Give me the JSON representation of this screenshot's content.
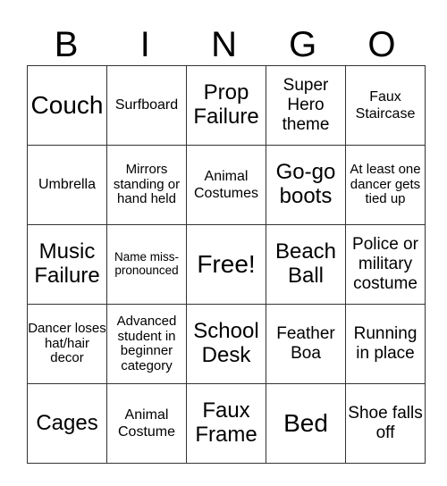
{
  "header": [
    "B",
    "I",
    "N",
    "G",
    "O"
  ],
  "grid": [
    [
      "Couch",
      "Surfboard",
      "Prop Failure",
      "Super Hero theme",
      "Faux Staircase"
    ],
    [
      "Umbrella",
      "Mirrors standing or hand held",
      "Animal Costumes",
      "Go-go boots",
      "At least one dancer gets tied up"
    ],
    [
      "Music Failure",
      "Name miss-pronounced",
      "Free!",
      "Beach Ball",
      "Police or military costume"
    ],
    [
      "Dancer loses hat/hair decor",
      "Advanced student in beginner category",
      "School Desk",
      "Feather Boa",
      "Running in place"
    ],
    [
      "Cages",
      "Animal Costume",
      "Faux Frame",
      "Bed",
      "Shoe falls off"
    ]
  ]
}
